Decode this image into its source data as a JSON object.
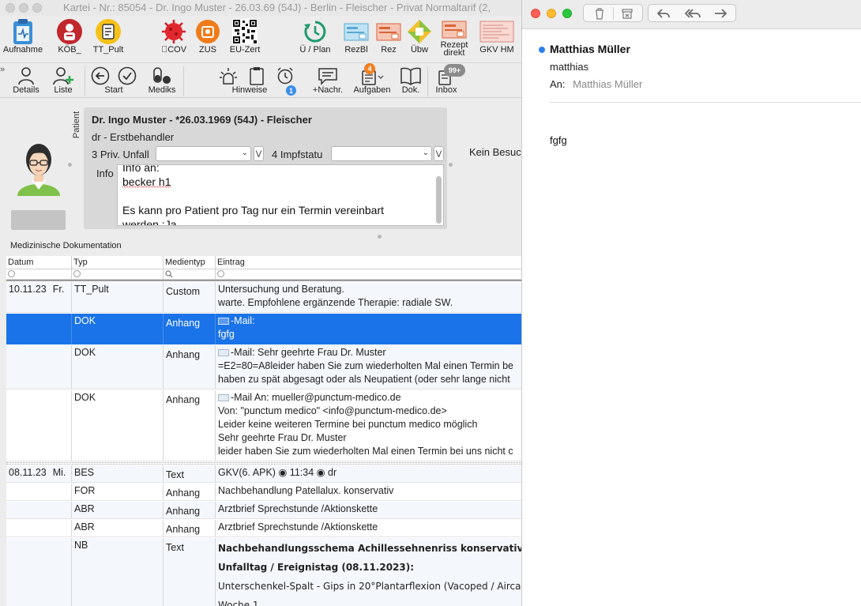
{
  "window": {
    "title": "Kartei - Nr.: 85054 - Dr. Ingo Muster - 26.03.69 (54J) - Berlin - Fleischer - Privat Normaltarif (2,"
  },
  "toolbar1": {
    "aufnahme": "Aufnahme",
    "koeb": "KÖB_",
    "tt_pult": "TT_Pult",
    "cov": "COV",
    "zus": "ZUS",
    "eu_zert": "EU-Zert",
    "ue_plan": "Ü / Plan",
    "rezbl": "RezBl",
    "rez": "Rez",
    "uebw": "Übw",
    "rezept_direkt": "Rezept direkt",
    "gkv_hm": "GKV HM"
  },
  "toolbar2": {
    "details": "Details",
    "liste": "Liste",
    "start": "Start",
    "mediks": "Mediks",
    "hinweise": "Hinweise",
    "hinweise_badge": "1",
    "nachr": "+Nachr.",
    "aufgaben": "Aufgaben",
    "aufgaben_badge": "4",
    "dok": "Dok.",
    "inbox": "Inbox",
    "inbox_badge": "99+"
  },
  "patient": {
    "side_label": "Patient",
    "header": "Dr. Ingo Muster - *26.03.1969 (54J) - Fleischer",
    "doctor": "dr - Erstbehandler",
    "field1_label": "3 Priv. Unfall",
    "field2_label": "4 Impfstatu",
    "info_label": "Info",
    "info_lines": [
      "Info an:",
      "becker h1",
      "",
      "Es kann pro Patient pro Tag nur ein Termin vereinbart",
      "werden.:Ja"
    ],
    "visit_status": "Kein Besuc"
  },
  "docs": {
    "section_title": "Medizinische Dokumentation",
    "columns": [
      "Datum",
      "Typ",
      "Medientyp",
      "Eintrag"
    ],
    "rows": [
      {
        "date": "10.11.23",
        "day": "Fr.",
        "typ": "TT_Pult",
        "medium": "Custom",
        "lines": [
          "Untersuchung und Beratung.",
          "warte. Empfohlene ergänzende Therapie: radiale SW."
        ]
      },
      {
        "date": "",
        "day": "",
        "typ": "DOK",
        "medium": "Anhang",
        "lines": [
          "-Mail:",
          "fgfg"
        ],
        "selected": true
      },
      {
        "date": "",
        "day": "",
        "typ": "DOK",
        "medium": "Anhang",
        "lines": [
          "-Mail:  Sehr geehrte Frau Dr. Muster",
          "=E2=80=A8leider haben Sie zum wiederholten Mal einen Termin be",
          "haben zu spät abgesagt oder als Neupatient (oder sehr lange nicht"
        ]
      },
      {
        "date": "",
        "day": "",
        "typ": "DOK",
        "medium": "Anhang",
        "lines": [
          "-Mail An: mueller@punctum-medico.de",
          "Von: \"punctum medico\" <info@punctum-medico.de>",
          "Leider keine weiteren Termine bei punctum medico möglich",
          "Sehr geehrte Frau Dr. Muster",
          "leider haben Sie zum wiederholten Mal einen Termin bei uns nicht c"
        ]
      },
      {
        "date": "08.11.23",
        "day": "Mi.",
        "typ": "BES",
        "medium": "Text",
        "lines": [
          "GKV(6. APK) ◉ 11:34 ◉ dr"
        ]
      },
      {
        "date": "",
        "day": "",
        "typ": "FOR",
        "medium": "Anhang",
        "lines": [
          "Nachbehandlung Patellalux. konservativ"
        ]
      },
      {
        "date": "",
        "day": "",
        "typ": "ABR",
        "medium": "Anhang",
        "lines": [
          "Arztbrief Sprechstunde /Aktionskette"
        ]
      },
      {
        "date": "",
        "day": "",
        "typ": "ABR",
        "medium": "Anhang",
        "lines": [
          "Arztbrief Sprechstunde /Aktionskette"
        ]
      },
      {
        "date": "",
        "day": "",
        "typ": "NB",
        "medium": "Text",
        "lines": [
          "Nachbehandlungsschema Achillessehnenriss konservativ",
          "Unfalltag / Ereignistag (08.11.2023):",
          "Unterschenkel-Spalt - Gips in 20°Plantarflexion (Vacoped / Airca",
          "Woche 1"
        ]
      }
    ]
  },
  "mail": {
    "sender": "Matthias Müller",
    "subject": "matthias",
    "to_label": "An:",
    "to": "Matthias Müller",
    "body": "fgfg"
  }
}
